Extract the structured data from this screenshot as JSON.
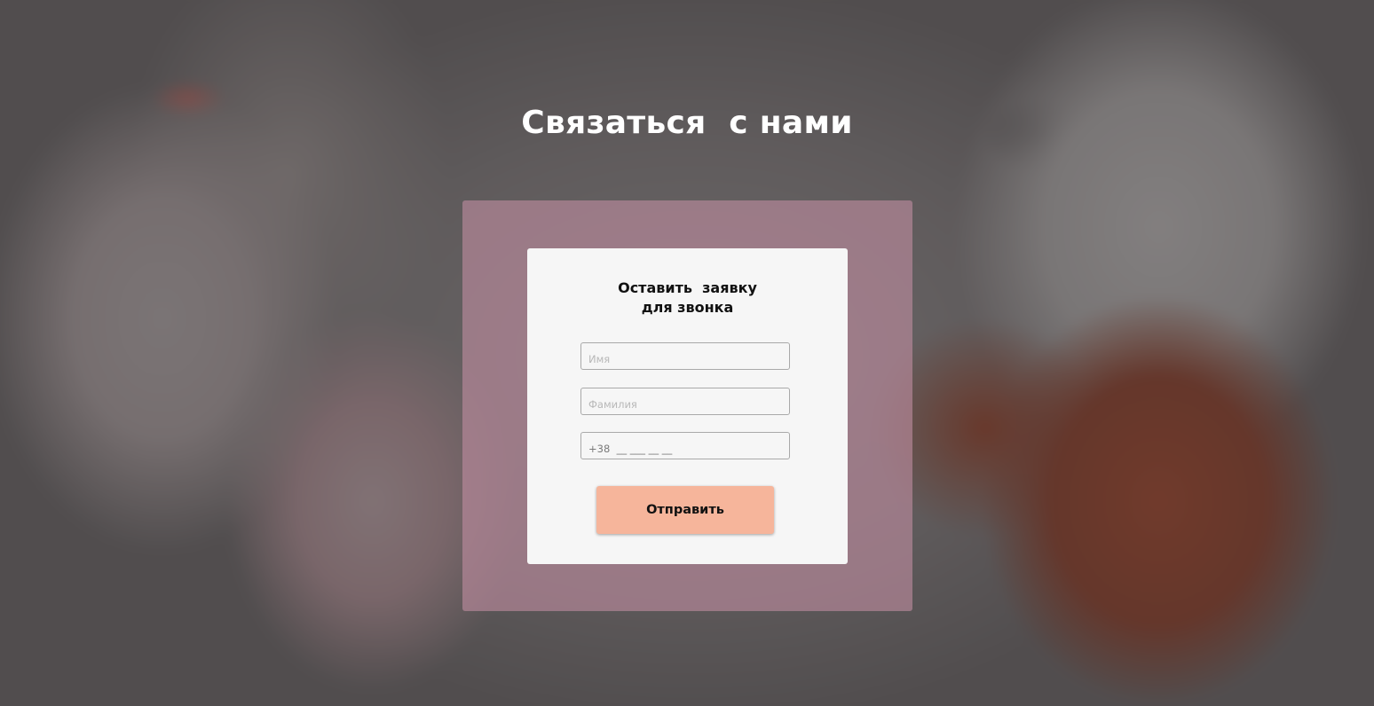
{
  "section": {
    "title": "Связаться  с нами"
  },
  "form": {
    "heading": "Оставить  заявку\nдля звонка",
    "fields": {
      "name_placeholder": "Имя",
      "surname_placeholder": "Фамилия",
      "phone_placeholder": "+38  __ ___ __ __"
    },
    "submit_label": "Отправить"
  },
  "colors": {
    "panel": "#be8ca0",
    "card": "#f6f6f6",
    "button": "#f6b59b",
    "title_text": "#ffffff"
  }
}
